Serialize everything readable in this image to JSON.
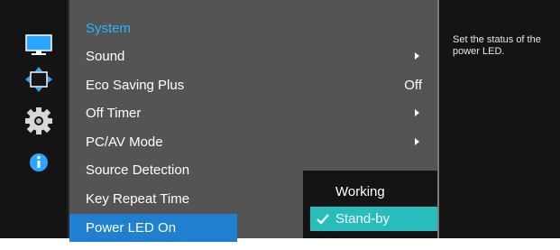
{
  "left_rail": {
    "icons": [
      "monitor-icon",
      "move-arrows-icon",
      "gear-icon",
      "info-icon"
    ]
  },
  "menu": {
    "header": "System",
    "items": [
      {
        "label": "Sound",
        "value": "",
        "has_arrow": true
      },
      {
        "label": "Eco Saving Plus",
        "value": "Off",
        "has_arrow": false
      },
      {
        "label": "Off Timer",
        "value": "",
        "has_arrow": true
      },
      {
        "label": "PC/AV Mode",
        "value": "",
        "has_arrow": true
      },
      {
        "label": "Source Detection",
        "value": "",
        "has_arrow": false
      },
      {
        "label": "Key Repeat Time",
        "value": "",
        "has_arrow": false
      },
      {
        "label": "Power LED On",
        "value": "",
        "has_arrow": false,
        "selected": true
      }
    ]
  },
  "submenu": {
    "options": [
      {
        "label": "Working",
        "checked": false
      },
      {
        "label": "Stand-by",
        "checked": true
      }
    ]
  },
  "info_panel": {
    "text": "Set the status of the power LED."
  },
  "colors": {
    "header": "#2bb3ff",
    "selected_row": "#1f7fd0",
    "selected_option": "#27bdbd",
    "menu_bg": "#545454",
    "panel_bg": "#141414"
  }
}
